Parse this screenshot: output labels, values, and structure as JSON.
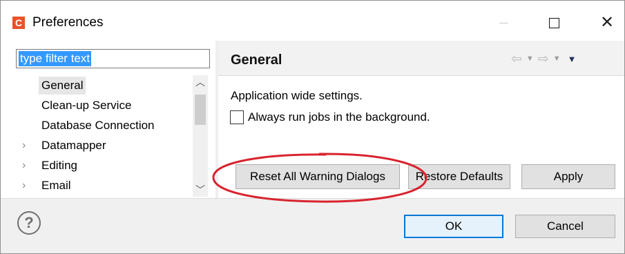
{
  "window": {
    "app_icon_letter": "C",
    "title": "Preferences",
    "icons": {
      "minimize": "minimize-icon",
      "maximize": "maximize-icon",
      "close": "close-icon"
    }
  },
  "filter": {
    "value": "type filter text"
  },
  "tree": {
    "items": [
      {
        "label": "General",
        "expandable": false,
        "selected": true
      },
      {
        "label": "Clean-up Service",
        "expandable": false,
        "selected": false
      },
      {
        "label": "Database Connection",
        "expandable": false,
        "selected": false
      },
      {
        "label": "Datamapper",
        "expandable": true,
        "selected": false
      },
      {
        "label": "Editing",
        "expandable": true,
        "selected": false
      },
      {
        "label": "Email",
        "expandable": true,
        "selected": false
      }
    ]
  },
  "page": {
    "title": "General",
    "description": "Application wide settings.",
    "checkbox_label": "Always run jobs in the background.",
    "checkbox_checked": false,
    "nav_icons": [
      "back-arrow-icon",
      "dropdown-icon",
      "forward-arrow-icon",
      "dropdown-icon",
      "view-menu-icon"
    ]
  },
  "buttons": {
    "reset_warnings": "Reset All Warning Dialogs",
    "restore_defaults": "Restore Defaults",
    "apply": "Apply",
    "ok": "OK",
    "cancel": "Cancel"
  },
  "colors": {
    "highlight_ellipse": "#d9232e",
    "app_icon": "#e8542a",
    "selection": "#3399ff",
    "default_button_border": "#0078d7"
  }
}
